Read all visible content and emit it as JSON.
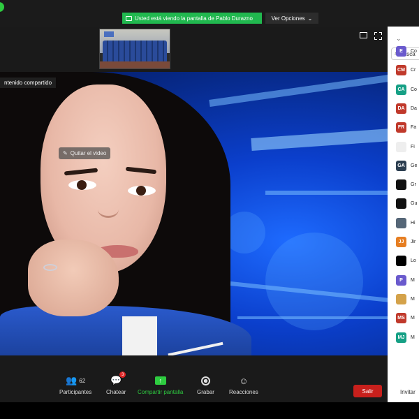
{
  "banner": {
    "sharing_text": "Usted está viendo la pantalla de Pablo Durazno",
    "view_options": "Ver Opciones"
  },
  "shared": {
    "label": "ntenido compartido",
    "remove_video": "Quitar el video"
  },
  "toolbar": {
    "participants_label": "Participantes",
    "participants_count": "62",
    "chat_label": "Chatear",
    "chat_badge": "3",
    "share_label": "Compartir pantalla",
    "record_label": "Grabar",
    "reactions_label": "Reacciones",
    "leave_label": "Salir"
  },
  "sidebar": {
    "search_placeholder": "Busca",
    "invite_label": "Invitar",
    "participants": [
      {
        "initials": "E",
        "name": "Co",
        "color": "#6a5acd"
      },
      {
        "initials": "CM",
        "name": "Cr",
        "color": "#c0392b"
      },
      {
        "initials": "CA",
        "name": "Co",
        "color": "#16a085"
      },
      {
        "initials": "DA",
        "name": "Da",
        "color": "#c0392b"
      },
      {
        "initials": "FR",
        "name": "Fa",
        "color": "#c0392b"
      },
      {
        "initials": "",
        "name": "Fi",
        "color": "#eeeeee"
      },
      {
        "initials": "GA",
        "name": "Ge",
        "color": "#2c3e50"
      },
      {
        "initials": "",
        "name": "Gr",
        "color": "#111111"
      },
      {
        "initials": "",
        "name": "Gu",
        "color": "#111111"
      },
      {
        "initials": "",
        "name": "Hi",
        "color": "#556677"
      },
      {
        "initials": "JJ",
        "name": "Jir",
        "color": "#e67e22"
      },
      {
        "initials": "",
        "name": "Lo",
        "color": "#000000"
      },
      {
        "initials": "P",
        "name": "M",
        "color": "#6a5acd"
      },
      {
        "initials": "",
        "name": "M",
        "color": "#d4a24a"
      },
      {
        "initials": "MS",
        "name": "M",
        "color": "#c0392b"
      },
      {
        "initials": "MJ",
        "name": "M",
        "color": "#16a085"
      }
    ]
  }
}
